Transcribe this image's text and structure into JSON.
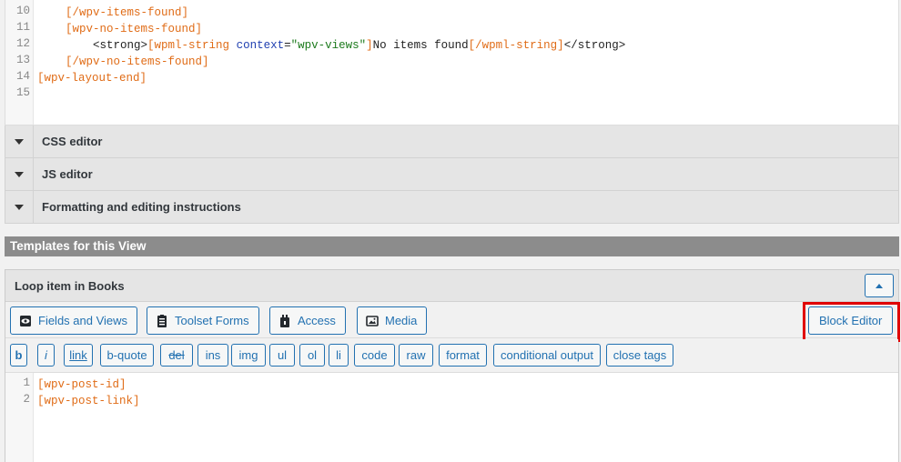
{
  "top_editor": {
    "line_numbers": [
      "10",
      "11",
      "12",
      "13",
      "14",
      "15"
    ],
    "lines": {
      "l10": "    [/wpv-items-found]",
      "l11": "    [wpv-no-items-found]",
      "l12_indent": "        ",
      "l12_strong_open": "<strong>",
      "l12_wpml_open": "[wpml-string ",
      "l12_attr": "context",
      "l12_eq": "=",
      "l12_value": "\"wpv-views\"",
      "l12_bracket": "]",
      "l12_text": "No items found",
      "l12_wpml_close": "[/wpml-string]",
      "l12_strong_close": "</strong>",
      "l13": "    [/wpv-no-items-found]",
      "l14": "[wpv-layout-end]"
    }
  },
  "accordions": {
    "css": "CSS editor",
    "js": "JS editor",
    "formatting": "Formatting and editing instructions"
  },
  "section_header": "Templates for this View",
  "panel": {
    "title": "Loop item in Books",
    "toolbar": {
      "fields_and_views": "Fields and Views",
      "toolset_forms": "Toolset Forms",
      "access": "Access",
      "media": "Media",
      "block_editor": "Block Editor"
    },
    "quicktags": [
      "b",
      "i",
      "link",
      "b-quote",
      "del",
      "ins",
      "img",
      "ul",
      "ol",
      "li",
      "code",
      "raw",
      "format",
      "conditional output",
      "close tags"
    ],
    "code": {
      "line_numbers": [
        "1",
        "2"
      ],
      "lines": [
        "[wpv-post-id]",
        "[wpv-post-link]"
      ]
    }
  },
  "colors": {
    "accent": "#2271b1",
    "shortcode": "#e06c17",
    "highlight": "#e00000"
  }
}
